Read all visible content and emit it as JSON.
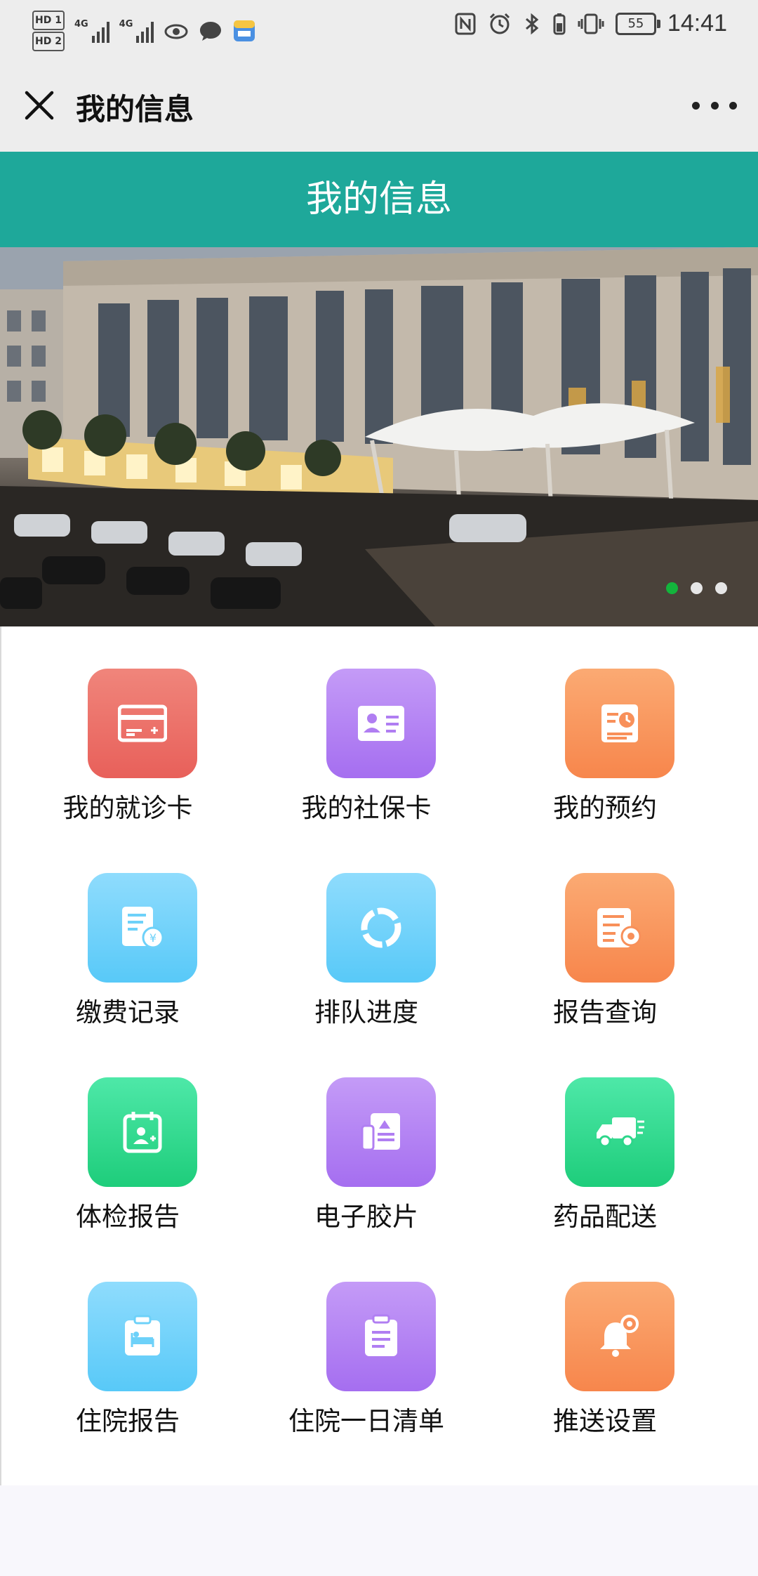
{
  "status_bar": {
    "hd1": "HD 1",
    "hd2": "HD 2",
    "net1": "4G",
    "net2": "4G",
    "battery": "55",
    "time": "14:41",
    "icons": [
      "eye-icon",
      "message-icon",
      "app-notification-icon",
      "nfc-icon",
      "alarm-icon",
      "bluetooth-icon",
      "vibrate-icon",
      "battery-icon"
    ]
  },
  "nav": {
    "title": "我的信息",
    "close_icon": "close-icon",
    "more_icon": "more-icon"
  },
  "header": {
    "title": "我的信息"
  },
  "banner": {
    "slides": 3,
    "active_slide": 1
  },
  "colors": {
    "header_bg": "#1ea89a",
    "active_dot": "#13b43c"
  },
  "menu": [
    {
      "label": "我的就诊卡",
      "icon": "medical-card-icon",
      "color": "red"
    },
    {
      "label": "我的社保卡",
      "icon": "social-security-card-icon",
      "color": "purple"
    },
    {
      "label": "我的预约",
      "icon": "appointment-icon",
      "color": "orange"
    },
    {
      "label": "缴费记录",
      "icon": "payment-record-icon",
      "color": "blue"
    },
    {
      "label": "排队进度",
      "icon": "queue-progress-icon",
      "color": "blue"
    },
    {
      "label": "报告查询",
      "icon": "report-query-icon",
      "color": "orange"
    },
    {
      "label": "体检报告",
      "icon": "checkup-report-icon",
      "color": "green"
    },
    {
      "label": "电子胶片",
      "icon": "electronic-film-icon",
      "color": "purple"
    },
    {
      "label": "药品配送",
      "icon": "delivery-truck-icon",
      "color": "green"
    },
    {
      "label": "住院报告",
      "icon": "hospital-bed-icon",
      "color": "blue"
    },
    {
      "label": "住院一日清单",
      "icon": "clipboard-list-icon",
      "color": "purple"
    },
    {
      "label": "推送设置",
      "icon": "bell-settings-icon",
      "color": "orange"
    }
  ]
}
